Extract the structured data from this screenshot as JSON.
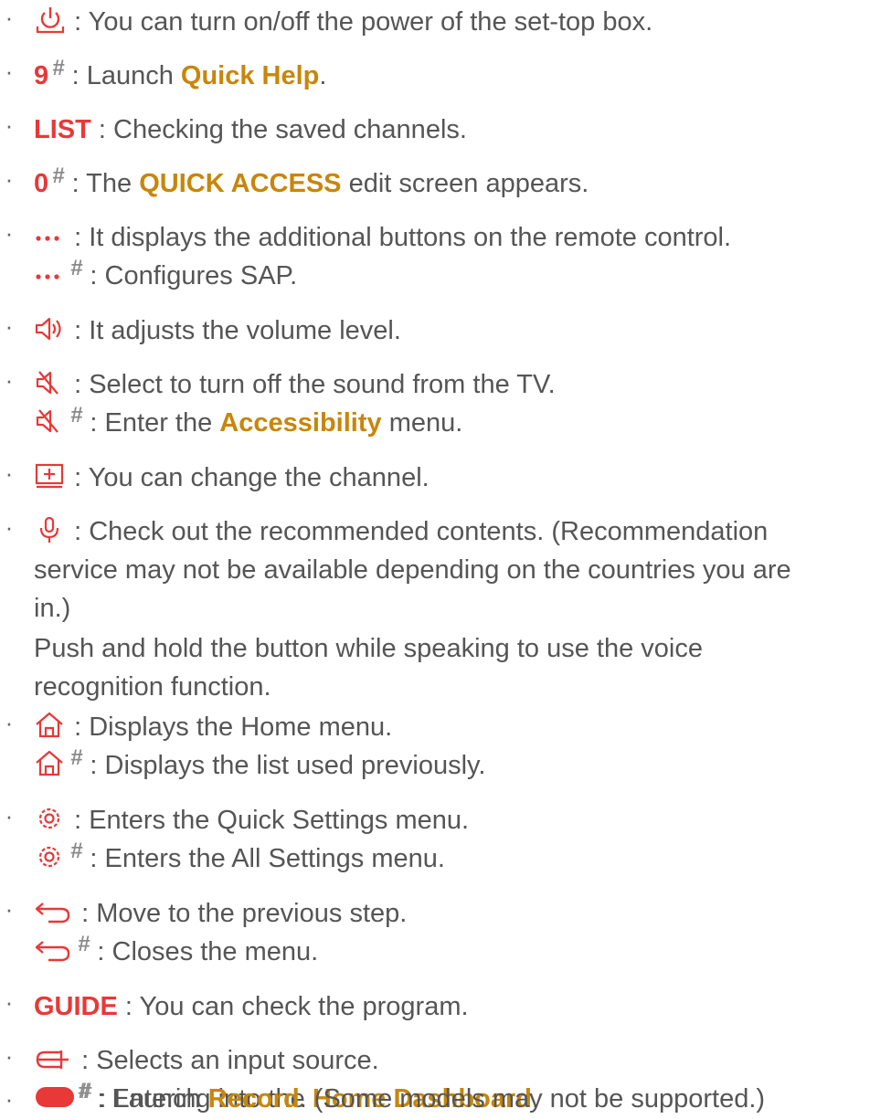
{
  "items": [
    {
      "power": {
        "sep": ":",
        "text": "You can turn on/off the power of the set-top box."
      }
    },
    {
      "nine": {
        "key": "9",
        "hash": "#",
        "sep": ":",
        "pre": "Launch",
        "hl": "Quick Help",
        "post": "."
      }
    },
    {
      "list": {
        "key": "LIST",
        "sep": ":",
        "text": "Checking the saved channels."
      }
    },
    {
      "zero": {
        "key": "0",
        "hash": "#",
        "sep": ":",
        "pre": "The",
        "hl": "QUICK ACCESS",
        "post": "edit screen appears."
      }
    },
    {
      "more": {
        "sep": ":",
        "text": "It displays the additional buttons on the remote control.",
        "hash": "#",
        "text2": "Configures SAP."
      }
    },
    {
      "volume": {
        "sep": ":",
        "text": "It adjusts the volume level."
      }
    },
    {
      "mute": {
        "sep": ":",
        "text": "Select to turn off the sound from the TV.",
        "hash": "#",
        "pre2": "Enter the",
        "hl2": "Accessibility",
        "post2": "menu."
      }
    },
    {
      "channel": {
        "sep": ":",
        "text": "You can change the channel."
      }
    },
    {
      "mic": {
        "sep": ":",
        "line1": "Check out the recommended contents. (Recommendation",
        "line2": "service may not be available depending on the countries you are",
        "line3": "in.)",
        "line4": "Push and hold the button while speaking to use the voice",
        "line5": "recognition function."
      }
    },
    {
      "home": {
        "sep": ":",
        "text": "Displays the Home menu.",
        "hash": "#",
        "text2": "Displays the list used previously."
      }
    },
    {
      "settings": {
        "sep": ":",
        "text": "Enters the Quick Settings menu.",
        "hash": "#",
        "text2": "Enters the All Settings menu."
      }
    },
    {
      "back": {
        "sep": ":",
        "text": "Move to the previous step.",
        "hash": "#",
        "text2": "Closes the menu."
      }
    },
    {
      "guide": {
        "key": "GUIDE",
        "sep": ":",
        "text": "You can check the program."
      }
    },
    {
      "input": {
        "sep": ":",
        "text": "Selects an input source.",
        "hash": "#",
        "pre2": "Entering into the",
        "hl2": "Home Dashboard",
        "post2": "."
      }
    },
    {
      "record": {
        "hash": "#",
        "sep": ":",
        "pre": "Launch",
        "hl": "Record",
        "post": ". (Some models may not be supported.)"
      }
    }
  ],
  "bullet": "·",
  "colors": {
    "key": "#e83838",
    "highlight": "#c8860a",
    "text": "#555555",
    "hash": "#8a8a8a"
  }
}
